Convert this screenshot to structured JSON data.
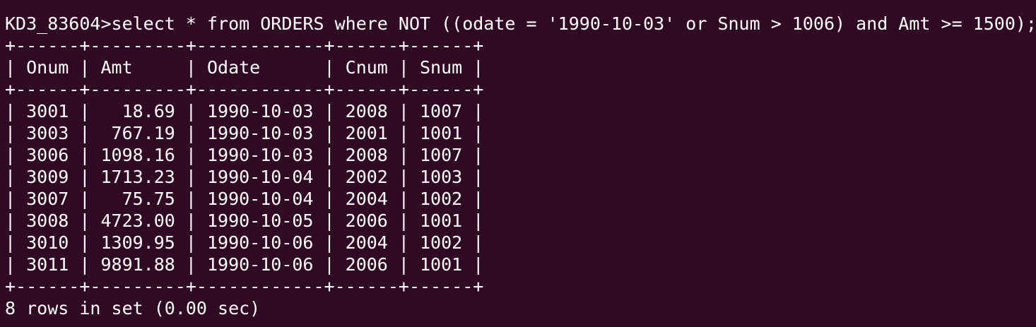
{
  "terminal": {
    "prompt": "KD3_83604>",
    "command": "select * from ORDERS where NOT ((odate = '1990-10-03' or Snum > 1006) and Amt >= 1500);",
    "table": {
      "border": "+------+---------+------------+------+------+",
      "header": "| Onum | Amt     | Odate      | Cnum | Snum |",
      "rows": [
        "| 3001 |   18.69 | 1990-10-03 | 2008 | 1007 |",
        "| 3003 |  767.19 | 1990-10-03 | 2001 | 1001 |",
        "| 3006 | 1098.16 | 1990-10-03 | 2008 | 1007 |",
        "| 3009 | 1713.23 | 1990-10-04 | 2002 | 1003 |",
        "| 3007 |   75.75 | 1990-10-04 | 2004 | 1002 |",
        "| 3008 | 4723.00 | 1990-10-05 | 2006 | 1001 |",
        "| 3010 | 1309.95 | 1990-10-06 | 2004 | 1002 |",
        "| 3011 | 9891.88 | 1990-10-06 | 2006 | 1001 |"
      ]
    },
    "status": "8 rows in set (0.00 sec)"
  },
  "colors": {
    "background": "#300a24",
    "foreground": "#ffffff"
  }
}
